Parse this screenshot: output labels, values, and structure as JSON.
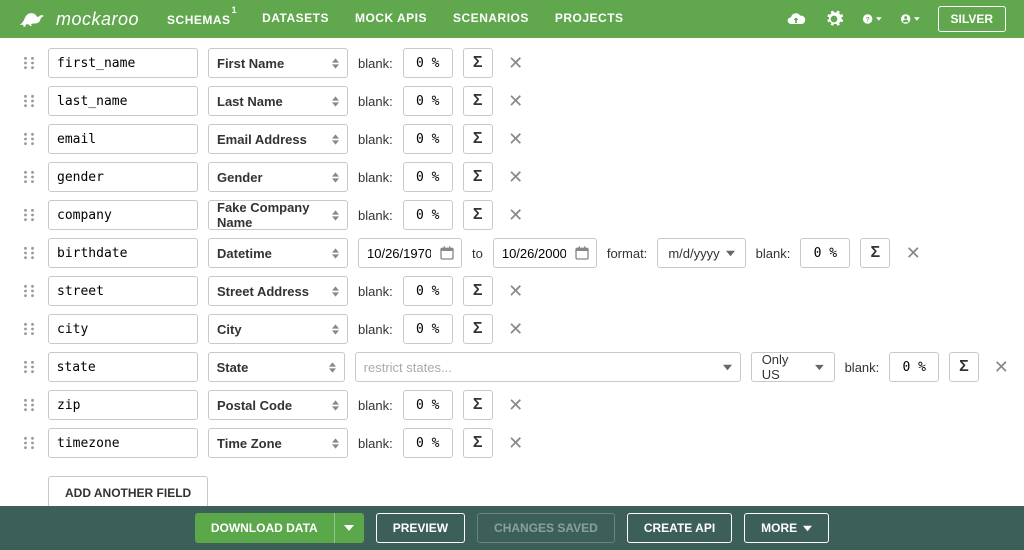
{
  "brand": {
    "name": "mockaroo"
  },
  "nav": {
    "items": [
      {
        "label": "SCHEMAS",
        "badge": "1"
      },
      {
        "label": "DATASETS"
      },
      {
        "label": "MOCK APIS"
      },
      {
        "label": "SCENARIOS"
      },
      {
        "label": "PROJECTS"
      }
    ],
    "plan_label": "SILVER"
  },
  "labels": {
    "blank": "blank:",
    "to": "to",
    "format": "format:",
    "sigma": "Σ",
    "restrict_placeholder": "restrict states..."
  },
  "fields": [
    {
      "name": "first_name",
      "type": "First Name",
      "blank": "0 %",
      "ext": "plain"
    },
    {
      "name": "last_name",
      "type": "Last Name",
      "blank": "0 %",
      "ext": "plain"
    },
    {
      "name": "email",
      "type": "Email Address",
      "blank": "0 %",
      "ext": "plain"
    },
    {
      "name": "gender",
      "type": "Gender",
      "blank": "0 %",
      "ext": "plain"
    },
    {
      "name": "company",
      "type": "Fake Company Name",
      "blank": "0 %",
      "ext": "plain"
    },
    {
      "name": "birthdate",
      "type": "Datetime",
      "blank": "0 %",
      "ext": "date",
      "from": "10/26/1970",
      "to": "10/26/2000",
      "format": "m/d/yyyy"
    },
    {
      "name": "street",
      "type": "Street Address",
      "blank": "0 %",
      "ext": "plain"
    },
    {
      "name": "city",
      "type": "City",
      "blank": "0 %",
      "ext": "plain"
    },
    {
      "name": "state",
      "type": "State",
      "blank": "0 %",
      "ext": "state",
      "onlyus": "Only US"
    },
    {
      "name": "zip",
      "type": "Postal Code",
      "blank": "0 %",
      "ext": "plain"
    },
    {
      "name": "timezone",
      "type": "Time Zone",
      "blank": "0 %",
      "ext": "plain"
    }
  ],
  "add_btn": "ADD ANOTHER FIELD",
  "bottom": {
    "download": "DOWNLOAD DATA",
    "preview": "PREVIEW",
    "saved": "CHANGES SAVED",
    "create": "CREATE API",
    "more": "MORE"
  }
}
